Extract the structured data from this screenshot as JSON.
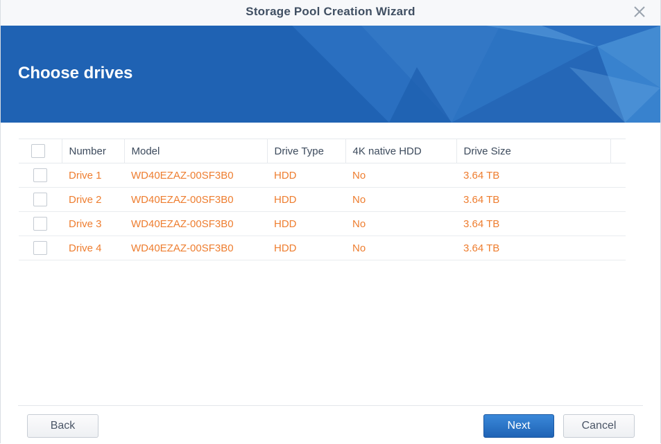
{
  "window": {
    "title": "Storage Pool Creation Wizard",
    "close_icon": "close-icon"
  },
  "banner": {
    "heading": "Choose drives"
  },
  "table": {
    "headers": [
      "Number",
      "Model",
      "Drive Type",
      "4K native HDD",
      "Drive Size"
    ],
    "rows": [
      {
        "number": "Drive 1",
        "model": "WD40EZAZ-00SF3B0",
        "type": "HDD",
        "native4k": "No",
        "size": "3.64 TB"
      },
      {
        "number": "Drive 2",
        "model": "WD40EZAZ-00SF3B0",
        "type": "HDD",
        "native4k": "No",
        "size": "3.64 TB"
      },
      {
        "number": "Drive 3",
        "model": "WD40EZAZ-00SF3B0",
        "type": "HDD",
        "native4k": "No",
        "size": "3.64 TB"
      },
      {
        "number": "Drive 4",
        "model": "WD40EZAZ-00SF3B0",
        "type": "HDD",
        "native4k": "No",
        "size": "3.64 TB"
      }
    ]
  },
  "footer": {
    "back_label": "Back",
    "next_label": "Next",
    "cancel_label": "Cancel"
  },
  "colors": {
    "accent": "#1f63b5",
    "row_text": "#ee7d2f",
    "header_text": "#3c4a5c"
  }
}
